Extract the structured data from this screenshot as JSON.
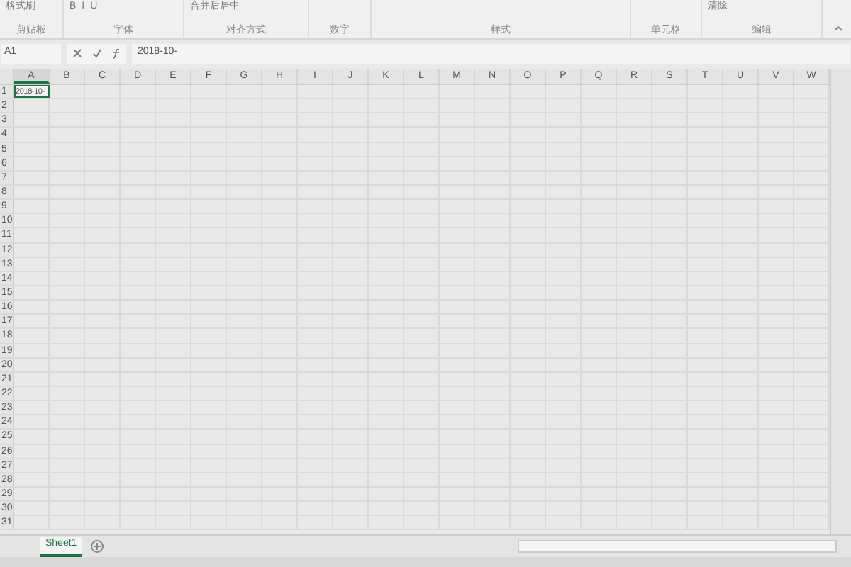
{
  "ribbon": {
    "groups": [
      {
        "label": "剪贴板",
        "items": [
          "格式刷"
        ]
      },
      {
        "label": "字体",
        "items": [
          "B",
          "I",
          "U"
        ]
      },
      {
        "label": "对齐方式",
        "items": [
          "合并后居中"
        ]
      },
      {
        "label": "数字"
      },
      {
        "label": "样式"
      },
      {
        "label": "单元格"
      },
      {
        "label": "编辑",
        "items": [
          "清除"
        ]
      }
    ]
  },
  "formula_bar": {
    "name_box": "A1",
    "formula": "2018-10-"
  },
  "sheet": {
    "columns": [
      "A",
      "B",
      "C",
      "D",
      "E",
      "F",
      "G",
      "H",
      "I",
      "J",
      "K",
      "L",
      "M",
      "N",
      "O",
      "P",
      "Q",
      "R",
      "S",
      "T",
      "U",
      "V",
      "W"
    ],
    "rows": [
      "1",
      "2",
      "3",
      "4",
      "5",
      "6",
      "7",
      "8",
      "9",
      "10",
      "11",
      "12",
      "13",
      "14",
      "15",
      "16",
      "17",
      "18",
      "19",
      "20",
      "21",
      "22",
      "23",
      "24",
      "25",
      "26",
      "27",
      "28",
      "29",
      "30",
      "31"
    ],
    "active_cell": {
      "value": "2018-10-"
    }
  },
  "sheet_tabs": [
    {
      "label": "Sheet1",
      "selected": true
    }
  ]
}
